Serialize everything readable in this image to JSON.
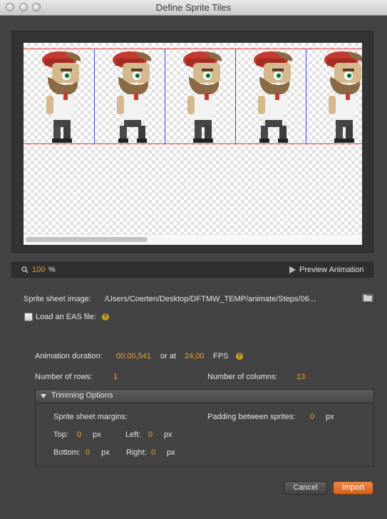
{
  "window": {
    "title": "Define Sprite Tiles"
  },
  "canvas": {
    "columns": 13,
    "rows": 1,
    "visible_frames": 5,
    "horizontal_scroll_fraction": 0.36
  },
  "zoom": {
    "value": "100",
    "unit": "%"
  },
  "preview_label": "Preview Animation",
  "sprite_sheet": {
    "label": "Sprite sheet image:",
    "path": "/Users/Coerten/Desktop/DFTMW_TEMP/animate/Steps/06..."
  },
  "eas": {
    "label": "Load an EAS file:",
    "checked": false,
    "help": "?"
  },
  "animation": {
    "duration_label": "Animation duration:",
    "duration_value": "00:00,541",
    "or_at": "or at",
    "fps_value": "24,00",
    "fps_unit": "FPS",
    "help": "?"
  },
  "rows_label": "Number of rows:",
  "rows_value": "1",
  "columns_label": "Number of columns:",
  "columns_value": "13",
  "trimming": {
    "header": "Trimming Options",
    "margins_label": "Sprite sheet margins:",
    "padding_label": "Padding between sprites:",
    "padding_value": "0",
    "top_label": "Top:",
    "top_value": "0",
    "left_label": "Left:",
    "left_value": "0",
    "bottom_label": "Bottom:",
    "bottom_value": "0",
    "right_label": "Right:",
    "right_value": "0",
    "unit": "px"
  },
  "buttons": {
    "cancel": "Cancel",
    "import": "Import"
  },
  "colors": {
    "accent": "#f0a033",
    "import_button": "#e0742f",
    "grid_row_line": "#e23b3b",
    "grid_column_line": "#3b4fd6"
  }
}
